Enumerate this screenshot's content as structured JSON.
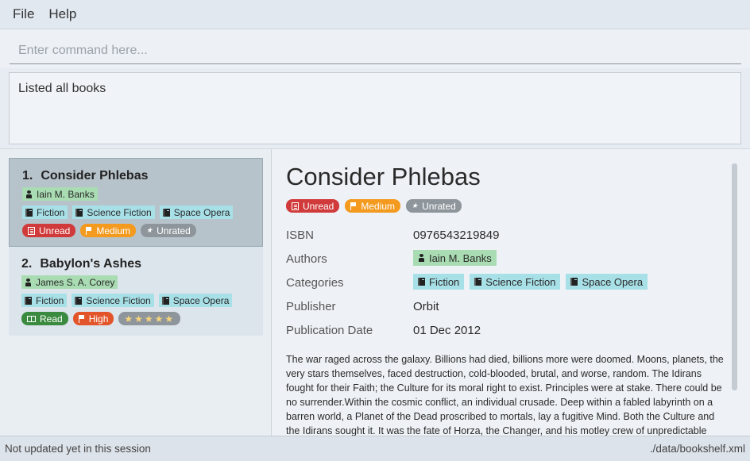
{
  "menu": {
    "file": "File",
    "help": "Help"
  },
  "command": {
    "placeholder": "Enter command here..."
  },
  "result": {
    "text": "Listed all books"
  },
  "books": [
    {
      "index": "1.",
      "title": "Consider Phlebas",
      "author": "Iain M. Banks",
      "categories": [
        "Fiction",
        "Science Fiction",
        "Space Opera"
      ],
      "status": "Unread",
      "priority": "Medium",
      "rating": "Unrated"
    },
    {
      "index": "2.",
      "title": "Babylon's Ashes",
      "author": "James S. A. Corey",
      "categories": [
        "Fiction",
        "Science Fiction",
        "Space Opera"
      ],
      "status": "Read",
      "priority": "High",
      "rating": "★★★★★"
    }
  ],
  "detail": {
    "title": "Consider Phlebas",
    "status": "Unread",
    "priority": "Medium",
    "rating": "Unrated",
    "labels": {
      "isbn": "ISBN",
      "authors": "Authors",
      "categories": "Categories",
      "publisher": "Publisher",
      "publication_date": "Publication Date"
    },
    "isbn": "0976543219849",
    "author": "Iain M. Banks",
    "categories": [
      "Fiction",
      "Science Fiction",
      "Space Opera"
    ],
    "publisher": "Orbit",
    "publication_date": "01 Dec 2012",
    "description": "The war raged across the galaxy. Billions had died, billions more were doomed. Moons, planets, the very stars themselves, faced destruction, cold-blooded, brutal, and worse, random. The Idirans fought for their Faith; the Culture for its moral right to exist. Principles were at stake. There could be no surrender.Within the cosmic conflict, an individual crusade. Deep within a fabled labyrinth on a barren world, a Planet of the Dead proscribed to mortals, lay a fugitive Mind. Both the Culture and the Idirans sought it. It was the fate of Horza, the Changer, and his motley crew of unpredictable mercenaries, human and machine, actually to find it, and with it their own destruction."
  },
  "status_bar": {
    "left": "Not updated yet in this session",
    "right": "./data/bookshelf.xml"
  },
  "colors": {
    "unread": "#d13a3a",
    "read": "#3a8a3f",
    "medium": "#f39a1f",
    "high": "#e2552a",
    "unrated": "#8e969c",
    "author_tag": "#a9dcb2",
    "category_tag": "#a8e0e8",
    "selected_card": "#b7c3cb"
  }
}
